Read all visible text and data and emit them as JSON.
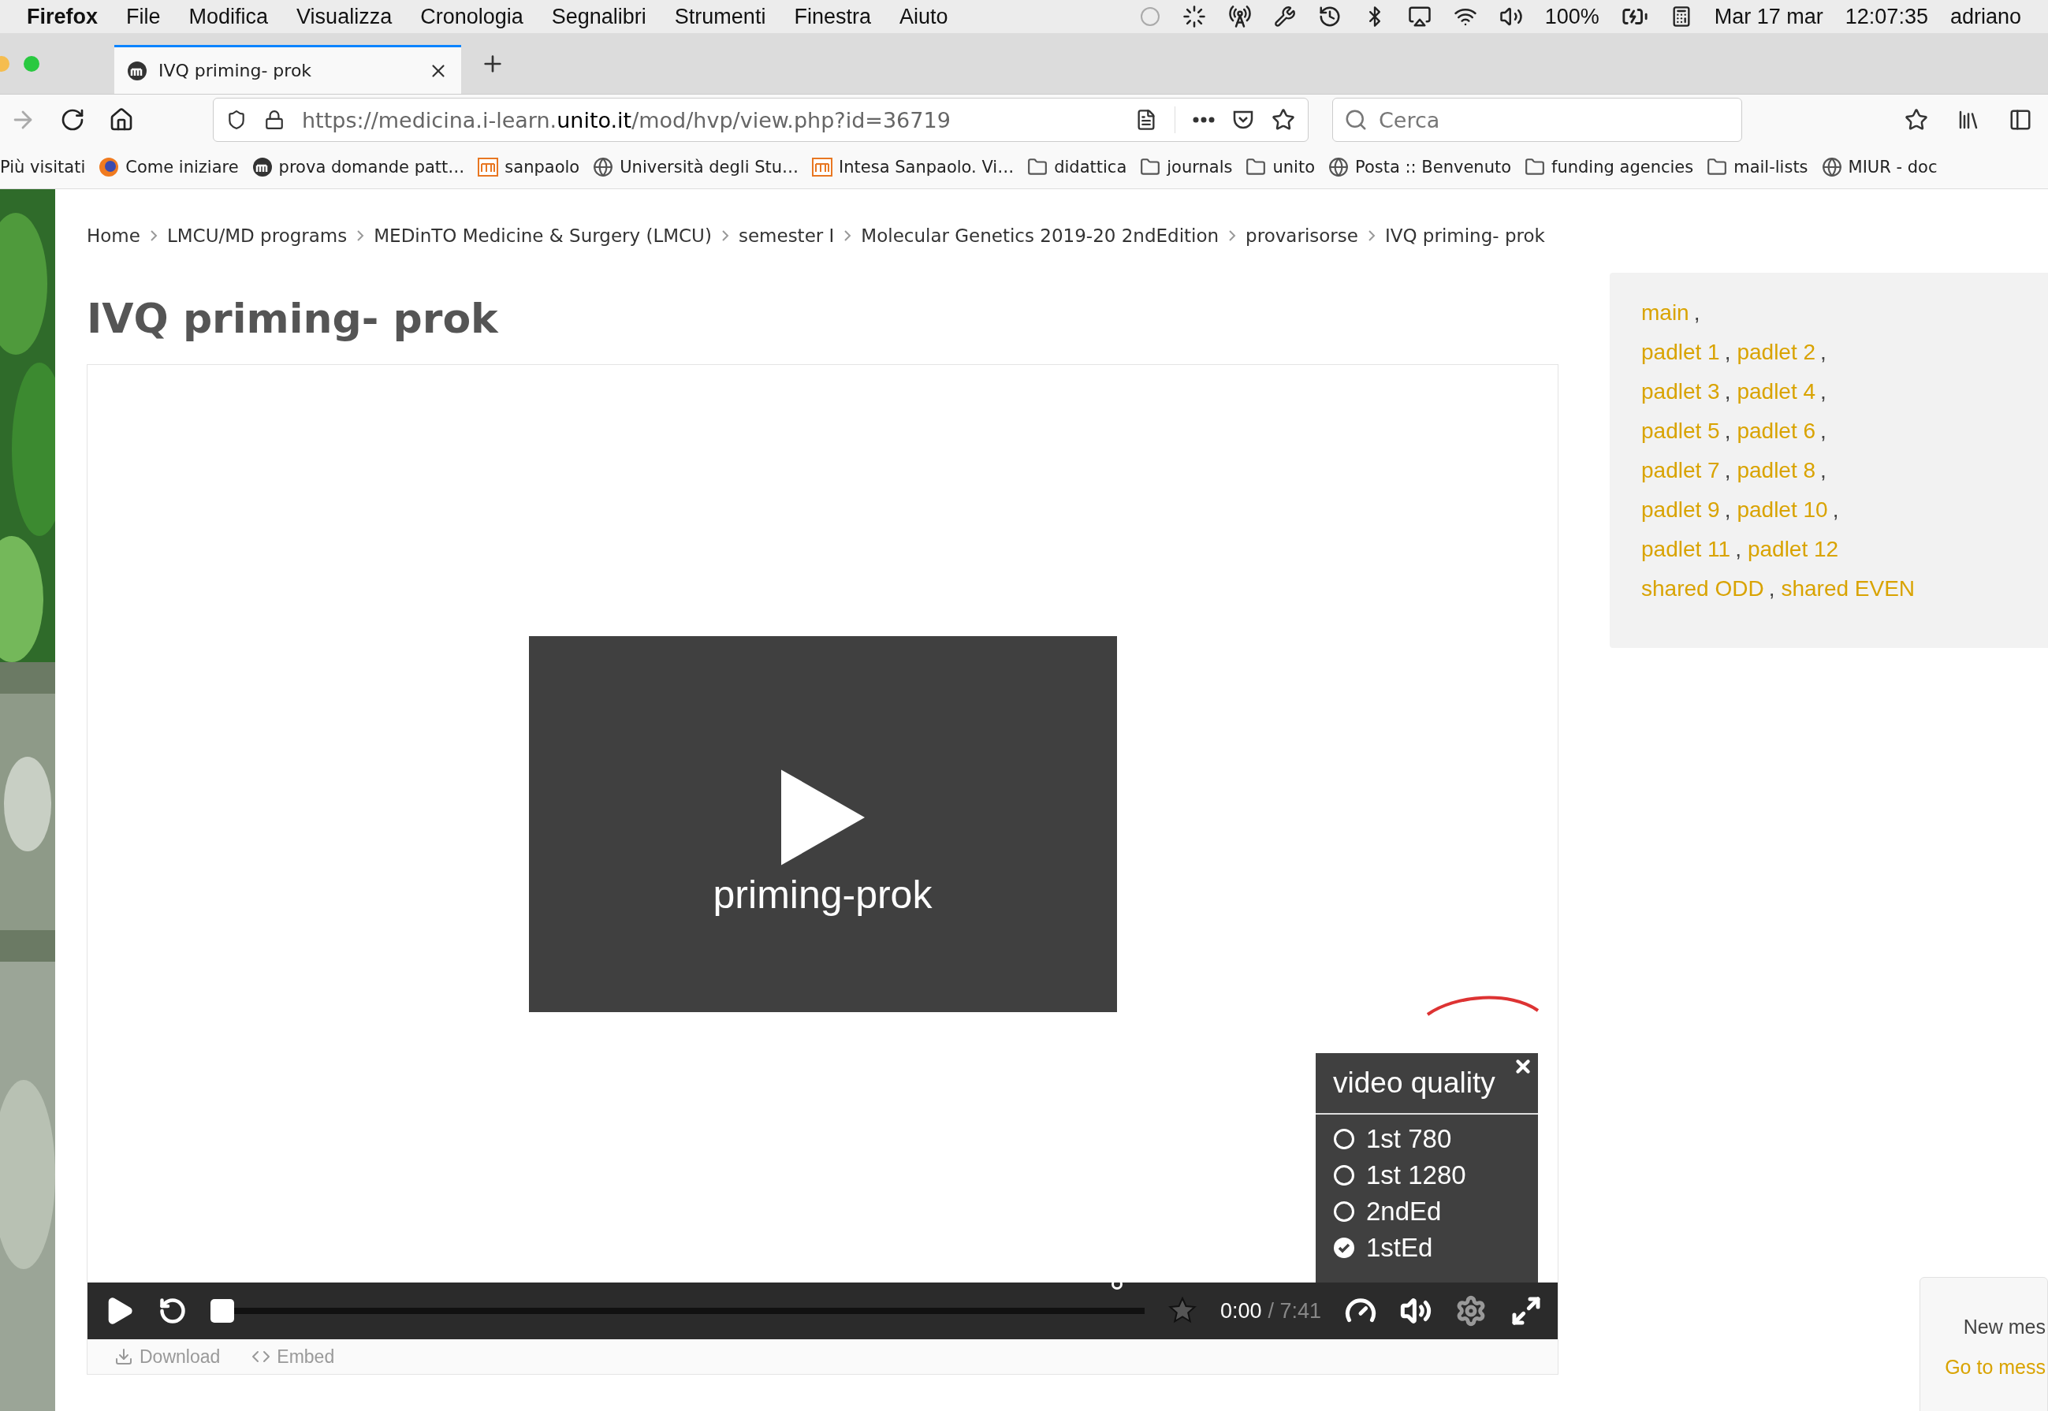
{
  "menubar": {
    "app": "Firefox",
    "items": [
      "File",
      "Modifica",
      "Visualizza",
      "Cronologia",
      "Segnalibri",
      "Strumenti",
      "Finestra",
      "Aiuto"
    ],
    "battery": "100%",
    "date": "Mar 17 mar",
    "time": "12:07:35",
    "user": "adriano"
  },
  "tabs": [
    {
      "title": "IVQ priming- prok",
      "selected": true
    }
  ],
  "address": {
    "url": "https://medicina.i-learn.**unito.it**/mod/hvp/view.php?id=36719"
  },
  "search": {
    "placeholder": "Cerca"
  },
  "bookmarks": [
    {
      "label": "Più visitati",
      "kind": "none"
    },
    {
      "label": "Come iniziare",
      "kind": "firefox"
    },
    {
      "label": "prova domande patt…",
      "kind": "site"
    },
    {
      "label": "sanpaolo",
      "kind": "bank"
    },
    {
      "label": "Università degli Stu…",
      "kind": "globe"
    },
    {
      "label": "Intesa Sanpaolo. Vi…",
      "kind": "bank"
    },
    {
      "label": "didattica",
      "kind": "folder"
    },
    {
      "label": "journals",
      "kind": "folder"
    },
    {
      "label": "unito",
      "kind": "folder"
    },
    {
      "label": "Posta :: Benvenuto",
      "kind": "globe"
    },
    {
      "label": "funding agencies",
      "kind": "folder"
    },
    {
      "label": "mail-lists",
      "kind": "folder"
    },
    {
      "label": "MIUR - doc",
      "kind": "globe"
    }
  ],
  "breadcrumb": [
    "Home",
    "LMCU/MD programs",
    "MEDinTO Medicine & Surgery (LMCU)",
    "semester I",
    "Molecular Genetics 2019-20 2ndEdition",
    "provarisorse",
    "IVQ priming- prok"
  ],
  "title": "IVQ priming- prok",
  "video": {
    "title": "priming-prok",
    "current": "0:00",
    "duration": "/ 7:41",
    "quality": {
      "title": "video quality",
      "options": [
        {
          "label": "1st 780",
          "selected": false
        },
        {
          "label": "1st 1280",
          "selected": false
        },
        {
          "label": "2ndEd",
          "selected": false
        },
        {
          "label": "1stEd",
          "selected": true
        }
      ]
    }
  },
  "actions": [
    {
      "label": "Download",
      "kind": "download"
    },
    {
      "label": "Embed",
      "kind": "embed"
    }
  ],
  "sidebar": {
    "rows": [
      [
        {
          "label": "main",
          "sep": ","
        }
      ],
      [
        {
          "label": "padlet 1",
          "sep": ","
        },
        {
          "label": "padlet 2",
          "sep": ","
        }
      ],
      [
        {
          "label": "padlet 3",
          "sep": ","
        },
        {
          "label": "padlet 4",
          "sep": ","
        }
      ],
      [
        {
          "label": "padlet 5",
          "sep": ","
        },
        {
          "label": "padlet 6",
          "sep": ","
        }
      ],
      [
        {
          "label": "padlet 7",
          "sep": ","
        },
        {
          "label": "padlet 8",
          "sep": ","
        }
      ],
      [
        {
          "label": "padlet 9",
          "sep": ","
        },
        {
          "label": "padlet 10",
          "sep": ","
        }
      ],
      [
        {
          "label": "padlet 11",
          "sep": ","
        },
        {
          "label": "padlet 12"
        }
      ],
      [
        {
          "label": "shared ODD",
          "sep": ","
        },
        {
          "label": "shared EVEN"
        }
      ]
    ]
  },
  "notification": {
    "text": "New mes",
    "link": "Go to mess"
  }
}
